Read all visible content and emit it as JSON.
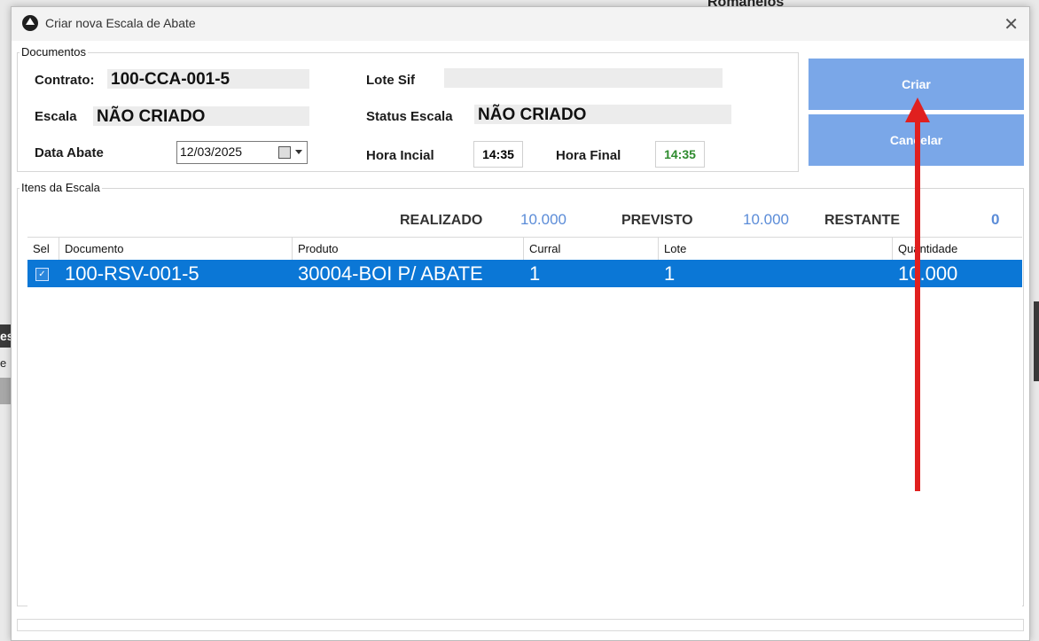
{
  "background": {
    "title_fragment": "Romaneios",
    "side_fragment_1": "es",
    "side_fragment_2": "e"
  },
  "dialog": {
    "title": "Criar nova Escala de Abate",
    "close_glyph": "✕"
  },
  "documentos": {
    "group_label": "Documentos",
    "contrato_label": "Contrato:",
    "contrato_value": "100-CCA-001-5",
    "escala_label": "Escala",
    "escala_value": "NÃO CRIADO",
    "data_abate_label": "Data Abate",
    "data_abate_value": "12/03/2025",
    "lote_sif_label": "Lote Sif",
    "lote_sif_value": "",
    "status_escala_label": "Status Escala",
    "status_escala_value": "NÃO CRIADO",
    "hora_inicial_label": "Hora Incial",
    "hora_inicial_value": "14:35",
    "hora_final_label": "Hora Final",
    "hora_final_value": "14:35",
    "hora_final_color": "#2e8b2e"
  },
  "buttons": {
    "criar": "Criar",
    "cancelar": "Cancelar",
    "color": "#7aa7e8"
  },
  "itens": {
    "group_label": "Itens da Escala",
    "realizado_label": "REALIZADO",
    "realizado_value": "10.000",
    "previsto_label": "PREVISTO",
    "previsto_value": "10.000",
    "restante_label": "RESTANTE",
    "restante_value": "0",
    "columns": [
      "Sel",
      "Documento",
      "Produto",
      "Curral",
      "Lote",
      "Quantidade"
    ],
    "rows": [
      {
        "sel": true,
        "documento": "100-RSV-001-5",
        "produto": "30004-BOI P/ ABATE",
        "curral": "1",
        "lote": "1",
        "quantidade": "10.000"
      }
    ],
    "selected_row_color": "#0b77d6"
  },
  "annotation": {
    "arrow_color": "#e0201f"
  }
}
